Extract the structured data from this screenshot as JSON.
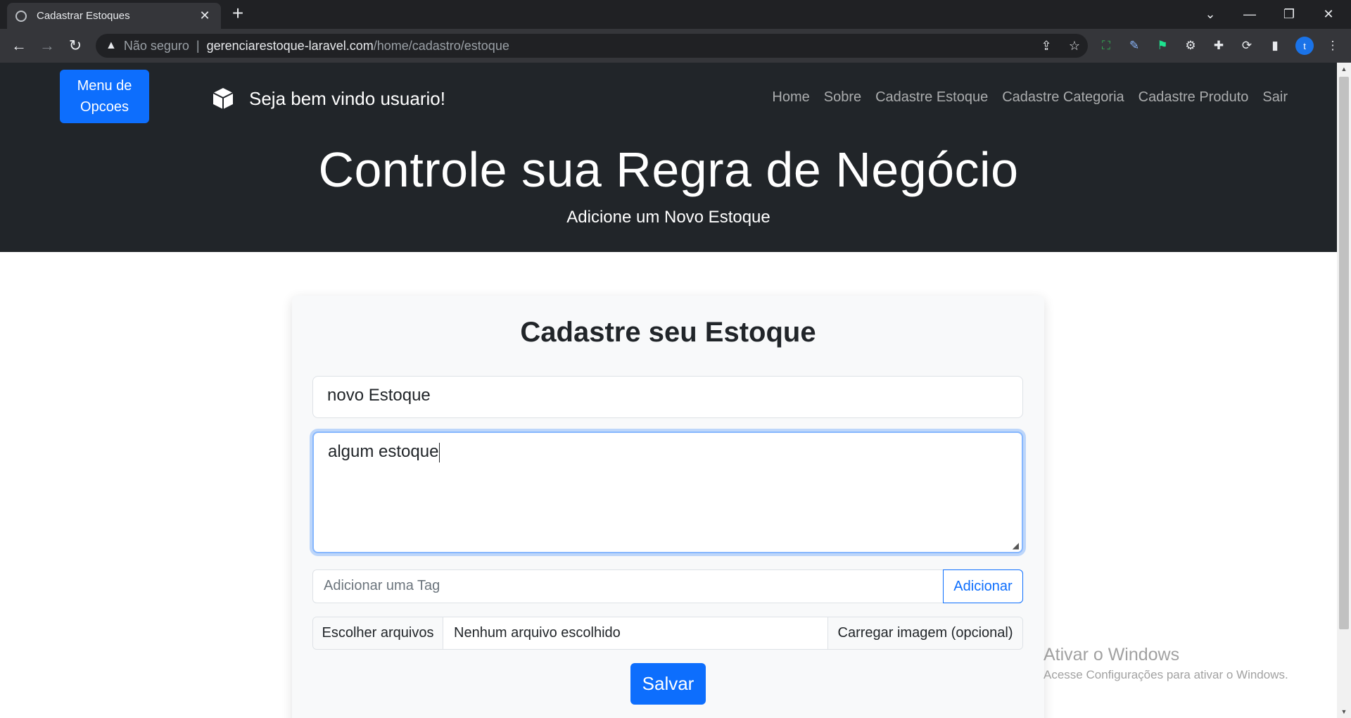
{
  "browser": {
    "tab_title": "Cadastrar Estoques",
    "tab_close": "✕",
    "new_tab": "+",
    "not_secure": "Não seguro",
    "separator": "|",
    "url_host": "gerenciarestoque-laravel.com",
    "url_path": "/home/cadastro/estoque",
    "profile_initial": "t"
  },
  "page": {
    "menu_button": "Menu de Opcoes",
    "welcome": "Seja bem vindo usuario!",
    "nav": [
      "Home",
      "Sobre",
      "Cadastre Estoque",
      "Cadastre Categoria",
      "Cadastre Produto",
      "Sair"
    ],
    "hero_title": "Controle sua Regra de Negócio",
    "hero_subtitle": "Adicione um Novo Estoque"
  },
  "form": {
    "title": "Cadastre seu Estoque",
    "name_value": "novo Estoque",
    "description_value": "algum estoque",
    "tag_placeholder": "Adicionar uma Tag",
    "tag_button": "Adicionar",
    "file_button": "Escolher arquivos",
    "file_status": "Nenhum arquivo escolhido",
    "file_label": "Carregar imagem (opcional)",
    "save_button": "Salvar"
  },
  "watermark": {
    "line1": "Ativar o Windows",
    "line2": "Acesse Configurações para ativar o Windows."
  },
  "colors": {
    "primary": "#0d6efd",
    "hero_bg": "#212529",
    "card_bg": "#f8f9fa"
  }
}
